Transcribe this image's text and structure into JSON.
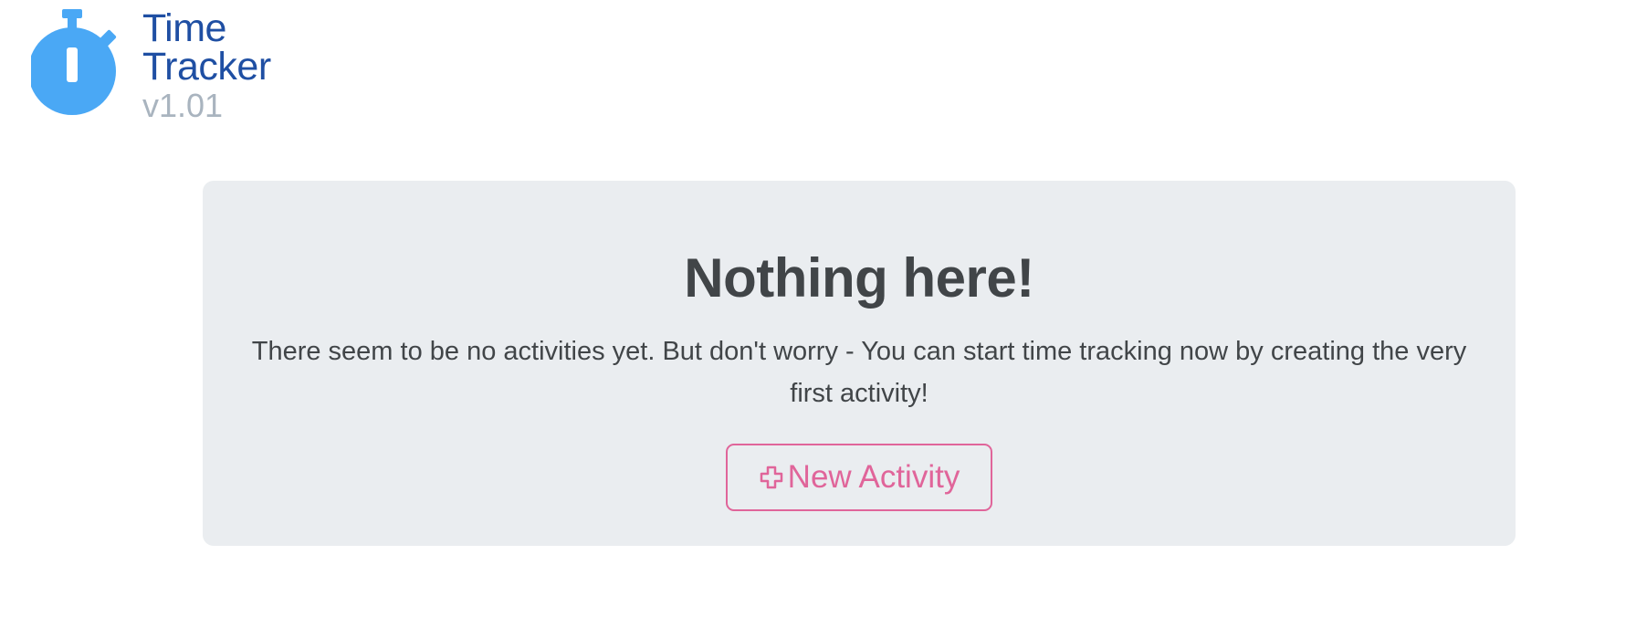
{
  "header": {
    "logo_icon": "stopwatch-icon",
    "title_line1": "Time",
    "title_line2": "Tracker",
    "version": "v1.01",
    "colors": {
      "logo": "#4aa8f5",
      "title": "#1f4fa3",
      "version": "#a9b4bf"
    }
  },
  "empty_state": {
    "title": "Nothing here!",
    "message": "There seem to be no activities yet. But don't worry - You can start time tracking now by creating the very first activity!",
    "button_label": "New Activity",
    "button_icon": "plus-icon",
    "colors": {
      "panel_bg": "#eaedf0",
      "text": "#414548",
      "accent": "#e0659a"
    }
  }
}
